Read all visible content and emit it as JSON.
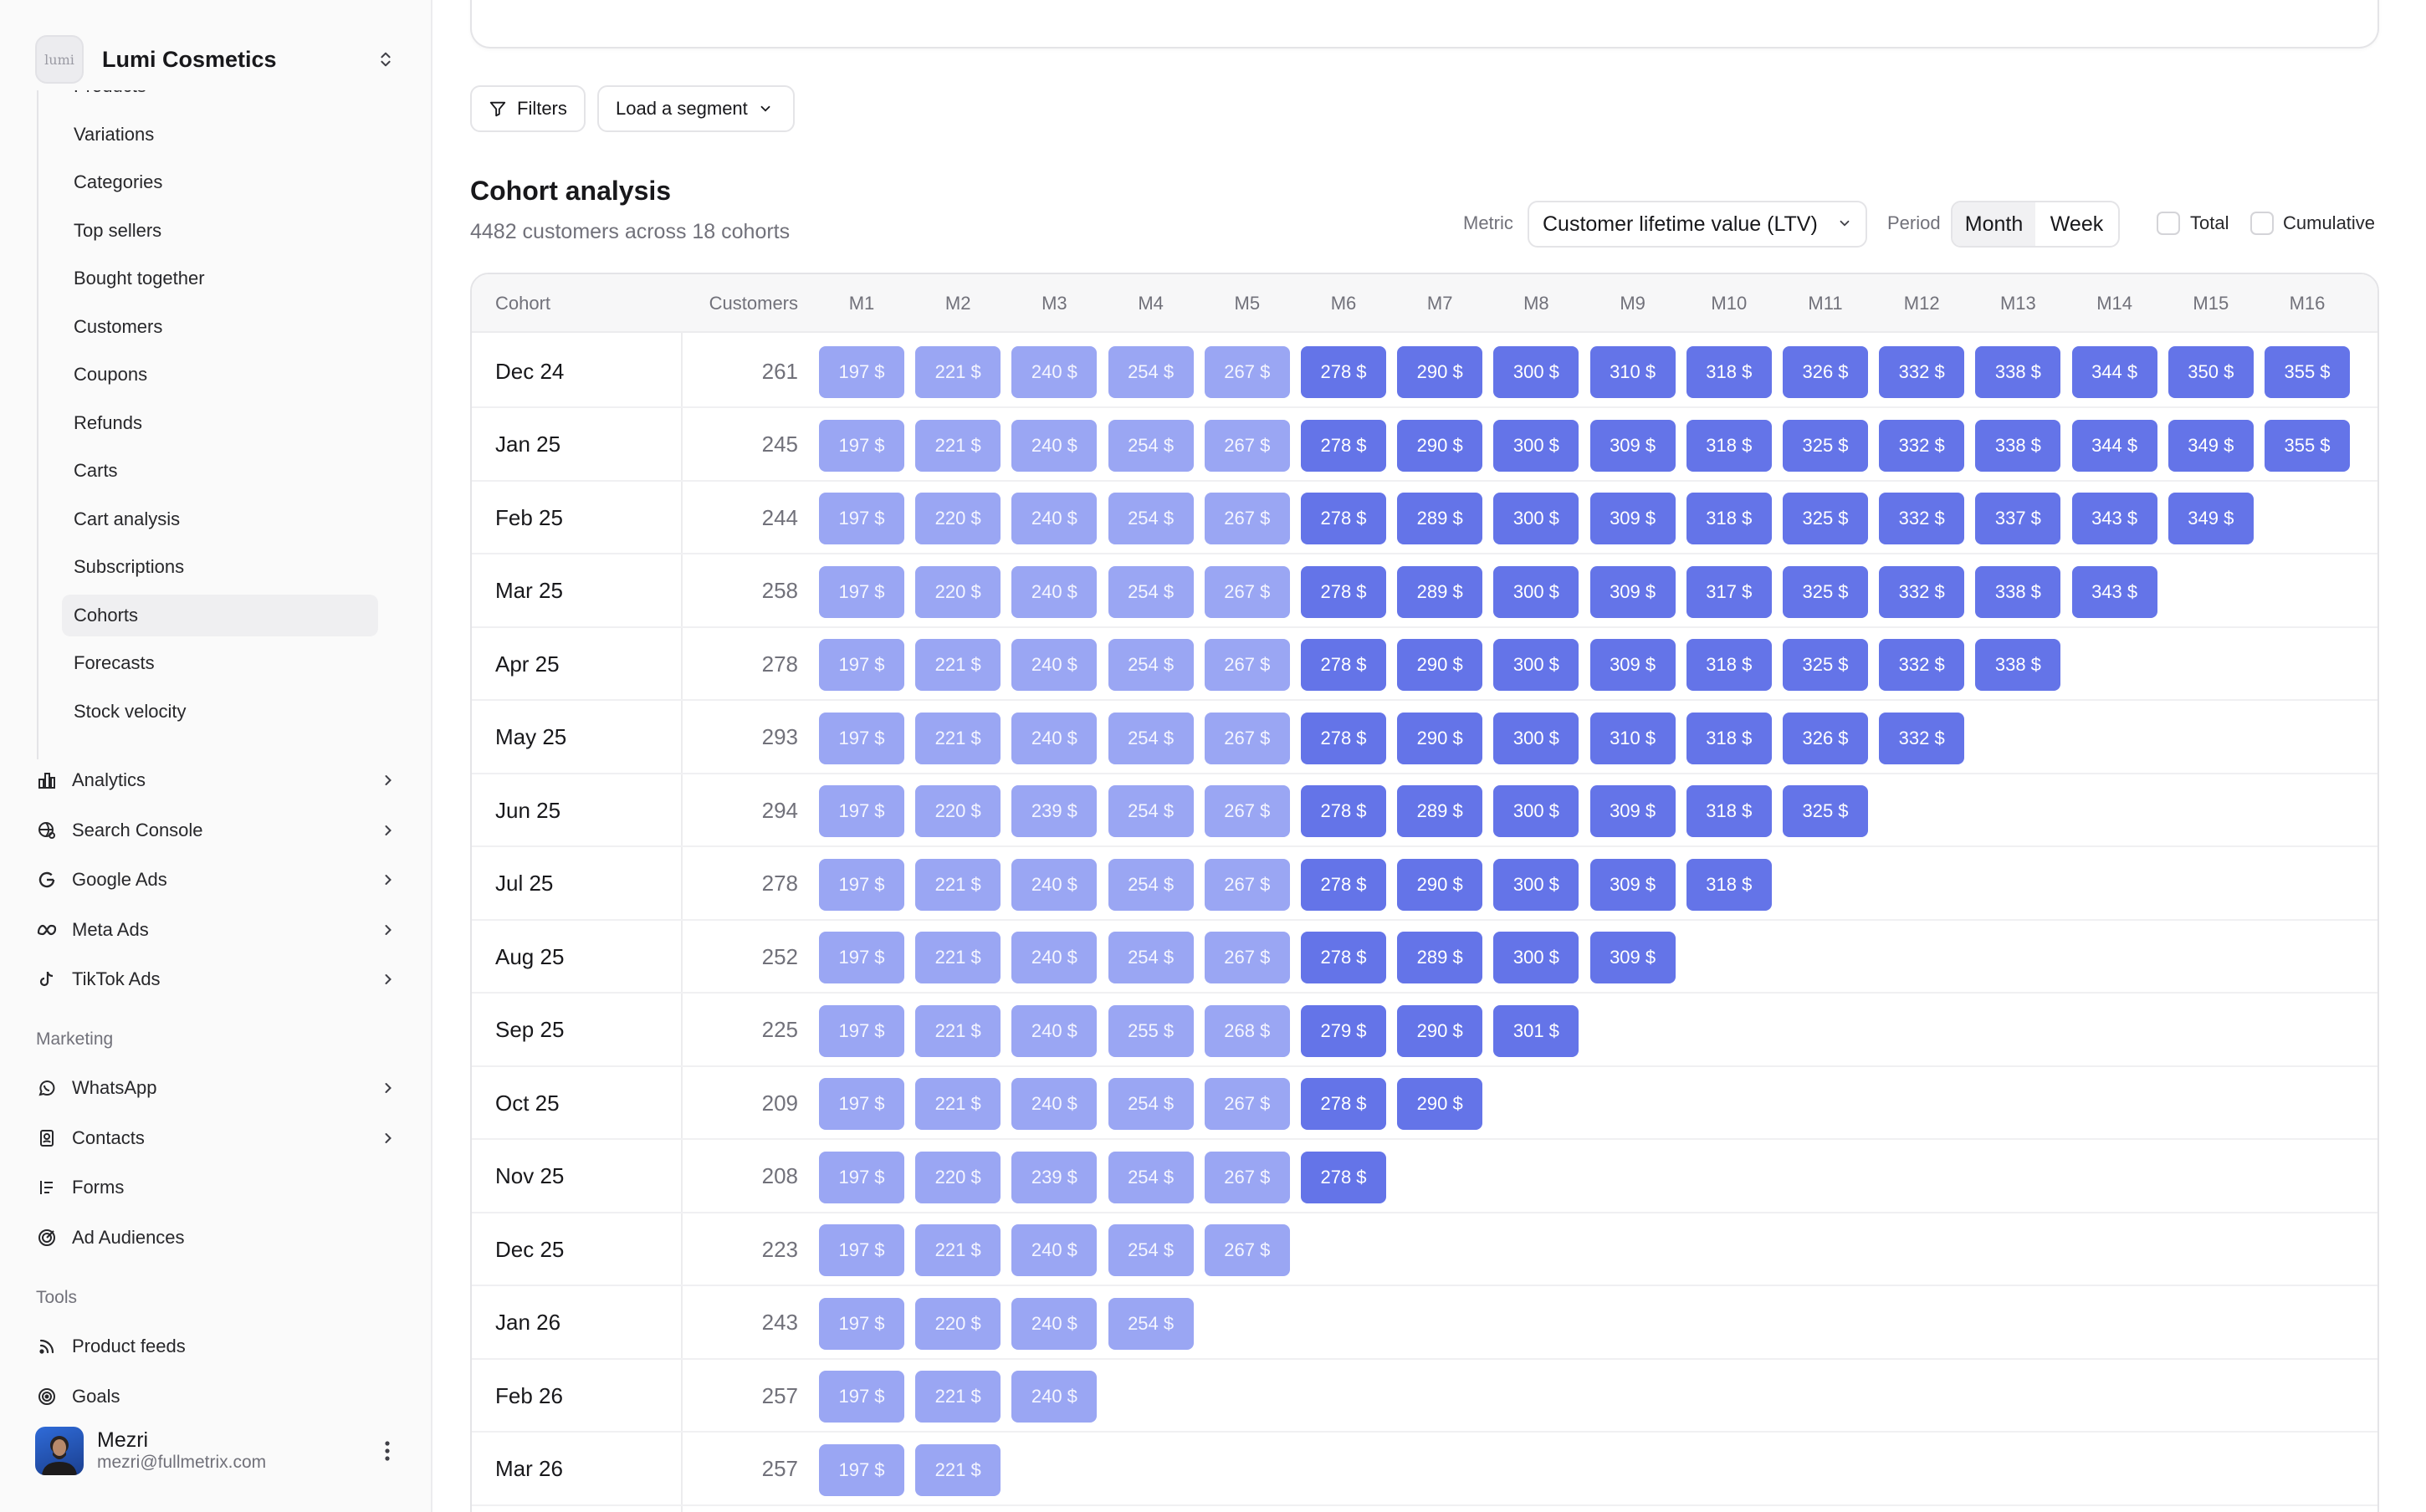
{
  "brand": {
    "name": "Lumi Cosmetics",
    "logo_text": "lumi"
  },
  "sidebar": {
    "subnav": [
      {
        "label": "Products",
        "active": false
      },
      {
        "label": "Variations",
        "active": false
      },
      {
        "label": "Categories",
        "active": false
      },
      {
        "label": "Top sellers",
        "active": false
      },
      {
        "label": "Bought together",
        "active": false
      },
      {
        "label": "Customers",
        "active": false
      },
      {
        "label": "Coupons",
        "active": false
      },
      {
        "label": "Refunds",
        "active": false
      },
      {
        "label": "Carts",
        "active": false
      },
      {
        "label": "Cart analysis",
        "active": false
      },
      {
        "label": "Subscriptions",
        "active": false
      },
      {
        "label": "Cohorts",
        "active": true
      },
      {
        "label": "Forecasts",
        "active": false
      },
      {
        "label": "Stock velocity",
        "active": false
      }
    ],
    "nav": [
      {
        "label": "Analytics",
        "icon": "bar-chart-icon"
      },
      {
        "label": "Search Console",
        "icon": "globe-search-icon"
      },
      {
        "label": "Google Ads",
        "icon": "google-icon"
      },
      {
        "label": "Meta Ads",
        "icon": "meta-icon"
      },
      {
        "label": "TikTok Ads",
        "icon": "tiktok-icon"
      }
    ],
    "marketing_title": "Marketing",
    "marketing": [
      {
        "label": "WhatsApp",
        "icon": "whatsapp-icon",
        "has_children": true
      },
      {
        "label": "Contacts",
        "icon": "contacts-icon",
        "has_children": true
      },
      {
        "label": "Forms",
        "icon": "forms-icon",
        "has_children": false
      },
      {
        "label": "Ad Audiences",
        "icon": "target-icon",
        "has_children": false
      }
    ],
    "tools_title": "Tools",
    "tools": [
      {
        "label": "Product feeds",
        "icon": "rss-icon"
      },
      {
        "label": "Goals",
        "icon": "goal-icon"
      }
    ],
    "user": {
      "name": "Mezri",
      "email": "mezri@fullmetrix.com"
    }
  },
  "toolbar": {
    "filters_label": "Filters",
    "segment_label": "Load a segment"
  },
  "header": {
    "title": "Cohort analysis",
    "subtitle": "4482 customers across 18 cohorts",
    "metric_label": "Metric",
    "metric_value": "Customer lifetime value (LTV)",
    "period_label": "Period",
    "period_options": [
      "Month",
      "Week"
    ],
    "period_selected": "Month",
    "total_label": "Total",
    "cumulative_label": "Cumulative"
  },
  "table": {
    "col_cohort": "Cohort",
    "col_customers": "Customers",
    "months": [
      "M1",
      "M2",
      "M3",
      "M4",
      "M5",
      "M6",
      "M7",
      "M8",
      "M9",
      "M10",
      "M11",
      "M12",
      "M13",
      "M14",
      "M15",
      "M16"
    ],
    "light_threshold": 5,
    "colors": {
      "light": "#9aa6f3",
      "dark": "#6474e8"
    },
    "rows": [
      {
        "cohort": "Dec 24",
        "customers": "261",
        "values": [
          "197 $",
          "221 $",
          "240 $",
          "254 $",
          "267 $",
          "278 $",
          "290 $",
          "300 $",
          "310 $",
          "318 $",
          "326 $",
          "332 $",
          "338 $",
          "344 $",
          "350 $",
          "355 $"
        ]
      },
      {
        "cohort": "Jan 25",
        "customers": "245",
        "values": [
          "197 $",
          "221 $",
          "240 $",
          "254 $",
          "267 $",
          "278 $",
          "290 $",
          "300 $",
          "309 $",
          "318 $",
          "325 $",
          "332 $",
          "338 $",
          "344 $",
          "349 $",
          "355 $"
        ]
      },
      {
        "cohort": "Feb 25",
        "customers": "244",
        "values": [
          "197 $",
          "220 $",
          "240 $",
          "254 $",
          "267 $",
          "278 $",
          "289 $",
          "300 $",
          "309 $",
          "318 $",
          "325 $",
          "332 $",
          "337 $",
          "343 $",
          "349 $"
        ]
      },
      {
        "cohort": "Mar 25",
        "customers": "258",
        "values": [
          "197 $",
          "220 $",
          "240 $",
          "254 $",
          "267 $",
          "278 $",
          "289 $",
          "300 $",
          "309 $",
          "317 $",
          "325 $",
          "332 $",
          "338 $",
          "343 $"
        ]
      },
      {
        "cohort": "Apr 25",
        "customers": "278",
        "values": [
          "197 $",
          "221 $",
          "240 $",
          "254 $",
          "267 $",
          "278 $",
          "290 $",
          "300 $",
          "309 $",
          "318 $",
          "325 $",
          "332 $",
          "338 $"
        ]
      },
      {
        "cohort": "May 25",
        "customers": "293",
        "values": [
          "197 $",
          "221 $",
          "240 $",
          "254 $",
          "267 $",
          "278 $",
          "290 $",
          "300 $",
          "310 $",
          "318 $",
          "326 $",
          "332 $"
        ]
      },
      {
        "cohort": "Jun 25",
        "customers": "294",
        "values": [
          "197 $",
          "220 $",
          "239 $",
          "254 $",
          "267 $",
          "278 $",
          "289 $",
          "300 $",
          "309 $",
          "318 $",
          "325 $"
        ]
      },
      {
        "cohort": "Jul 25",
        "customers": "278",
        "values": [
          "197 $",
          "221 $",
          "240 $",
          "254 $",
          "267 $",
          "278 $",
          "290 $",
          "300 $",
          "309 $",
          "318 $"
        ]
      },
      {
        "cohort": "Aug 25",
        "customers": "252",
        "values": [
          "197 $",
          "221 $",
          "240 $",
          "254 $",
          "267 $",
          "278 $",
          "289 $",
          "300 $",
          "309 $"
        ]
      },
      {
        "cohort": "Sep 25",
        "customers": "225",
        "values": [
          "197 $",
          "221 $",
          "240 $",
          "255 $",
          "268 $",
          "279 $",
          "290 $",
          "301 $"
        ]
      },
      {
        "cohort": "Oct 25",
        "customers": "209",
        "values": [
          "197 $",
          "221 $",
          "240 $",
          "254 $",
          "267 $",
          "278 $",
          "290 $"
        ]
      },
      {
        "cohort": "Nov 25",
        "customers": "208",
        "values": [
          "197 $",
          "220 $",
          "239 $",
          "254 $",
          "267 $",
          "278 $"
        ]
      },
      {
        "cohort": "Dec 25",
        "customers": "223",
        "values": [
          "197 $",
          "221 $",
          "240 $",
          "254 $",
          "267 $"
        ]
      },
      {
        "cohort": "Jan 26",
        "customers": "243",
        "values": [
          "197 $",
          "220 $",
          "240 $",
          "254 $"
        ]
      },
      {
        "cohort": "Feb 26",
        "customers": "257",
        "values": [
          "197 $",
          "221 $",
          "240 $"
        ]
      },
      {
        "cohort": "Mar 26",
        "customers": "257",
        "values": [
          "197 $",
          "221 $"
        ]
      }
    ]
  }
}
